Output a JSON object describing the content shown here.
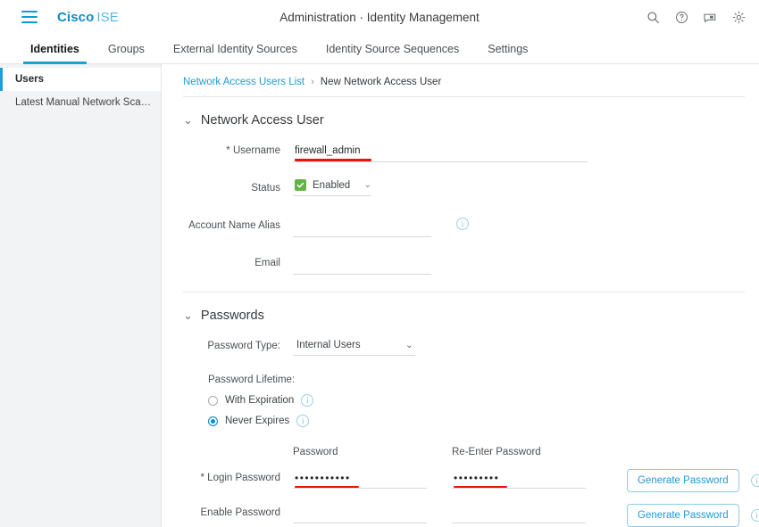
{
  "header": {
    "brand_primary": "Cisco",
    "brand_secondary": "ISE",
    "title": "Administration · Identity Management",
    "menu_icon": "hamburger-icon",
    "icons": [
      "search-icon",
      "help-icon",
      "feedback-icon",
      "gear-icon"
    ],
    "brand_color": "#0d8cc4",
    "accent_color": "#1ba0d7"
  },
  "tabs": [
    {
      "label": "Identities",
      "active": true
    },
    {
      "label": "Groups",
      "active": false
    },
    {
      "label": "External Identity Sources",
      "active": false
    },
    {
      "label": "Identity Source Sequences",
      "active": false
    },
    {
      "label": "Settings",
      "active": false
    }
  ],
  "sidebar": {
    "items": [
      {
        "label": "Users",
        "active": true
      },
      {
        "label": "Latest Manual Network Scan Res...",
        "active": false
      }
    ]
  },
  "breadcrumb": {
    "link": "Network Access Users List",
    "separator": "›",
    "current": "New Network Access User"
  },
  "network_access_user": {
    "section_title": "Network Access User",
    "username_label": "* Username",
    "username_value": "firewall_admin",
    "username_placeholder": "",
    "status_label": "Status",
    "status_value": "Enabled",
    "status_checked": true,
    "alias_label": "Account Name Alias",
    "alias_value": "",
    "alias_placeholder": "",
    "alias_info": "info-icon",
    "email_label": "Email",
    "email_value": "",
    "email_placeholder": ""
  },
  "passwords": {
    "section_title": "Passwords",
    "password_type_label": "Password Type:",
    "password_type_value": "Internal Users",
    "password_type_options": [
      "Internal Users"
    ],
    "lifetime_label": "Password Lifetime:",
    "lifetime_options": [
      {
        "label": "With Expiration",
        "selected": false
      },
      {
        "label": "Never Expires",
        "selected": true
      }
    ],
    "col_password": "Password",
    "col_reenter": "Re-Enter Password",
    "login_password_label": "* Login Password",
    "login_password_value": "•••••••••••",
    "login_password_reenter_value": "•••••••••",
    "enable_password_label": "Enable Password",
    "enable_password_value": "",
    "enable_password_reenter_value": "",
    "generate_button": "Generate Password",
    "generate_button_2": "Generate Password"
  },
  "annotation": {
    "color": "#e8120e",
    "targets": [
      "username-field",
      "login-password-field",
      "login-password-reenter-field"
    ]
  }
}
